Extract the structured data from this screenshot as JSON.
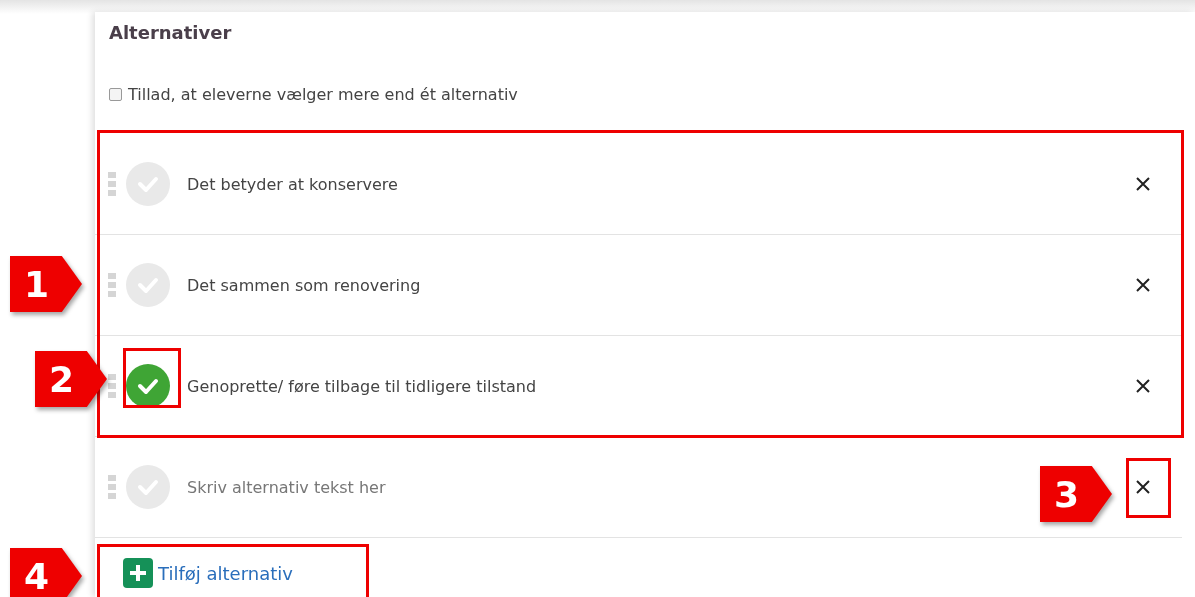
{
  "section": {
    "title": "Alternativer"
  },
  "multiple_choice": {
    "label": "Tillad, at eleverne vælger mere end ét alternativ",
    "checked": false
  },
  "alternatives": [
    {
      "kind": "text",
      "text": "Det betyder at konservere",
      "correct": false
    },
    {
      "kind": "text",
      "text": "Det sammen som renovering",
      "correct": false
    },
    {
      "kind": "text",
      "text": "Genoprette/ føre tilbage til tidligere tilstand",
      "correct": true
    },
    {
      "kind": "empty",
      "placeholder": "Skriv alternativ tekst her",
      "correct": false
    }
  ],
  "add_button": {
    "label": "Tilføj alternativ"
  },
  "callouts": [
    {
      "label": "1"
    },
    {
      "label": "2"
    },
    {
      "label": "3"
    },
    {
      "label": "4"
    }
  ]
}
